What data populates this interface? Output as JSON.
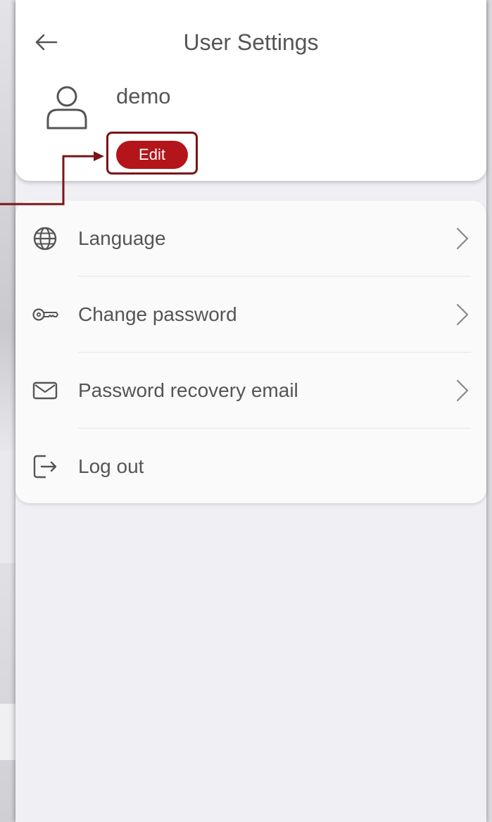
{
  "header": {
    "title": "User Settings",
    "back_icon": "arrow-left-icon"
  },
  "profile": {
    "username": "demo",
    "avatar_icon": "user-icon",
    "edit_label": "Edit"
  },
  "menu": {
    "items": [
      {
        "label": "Language",
        "icon": "globe-icon",
        "has_chevron": true
      },
      {
        "label": "Change password",
        "icon": "key-icon",
        "has_chevron": true
      },
      {
        "label": "Password recovery email",
        "icon": "envelope-icon",
        "has_chevron": true
      },
      {
        "label": "Log out",
        "icon": "logout-icon",
        "has_chevron": false
      }
    ]
  },
  "colors": {
    "accent": "#b3151b",
    "callout": "#7a1416",
    "text": "#555555",
    "background": "#efeff4"
  }
}
